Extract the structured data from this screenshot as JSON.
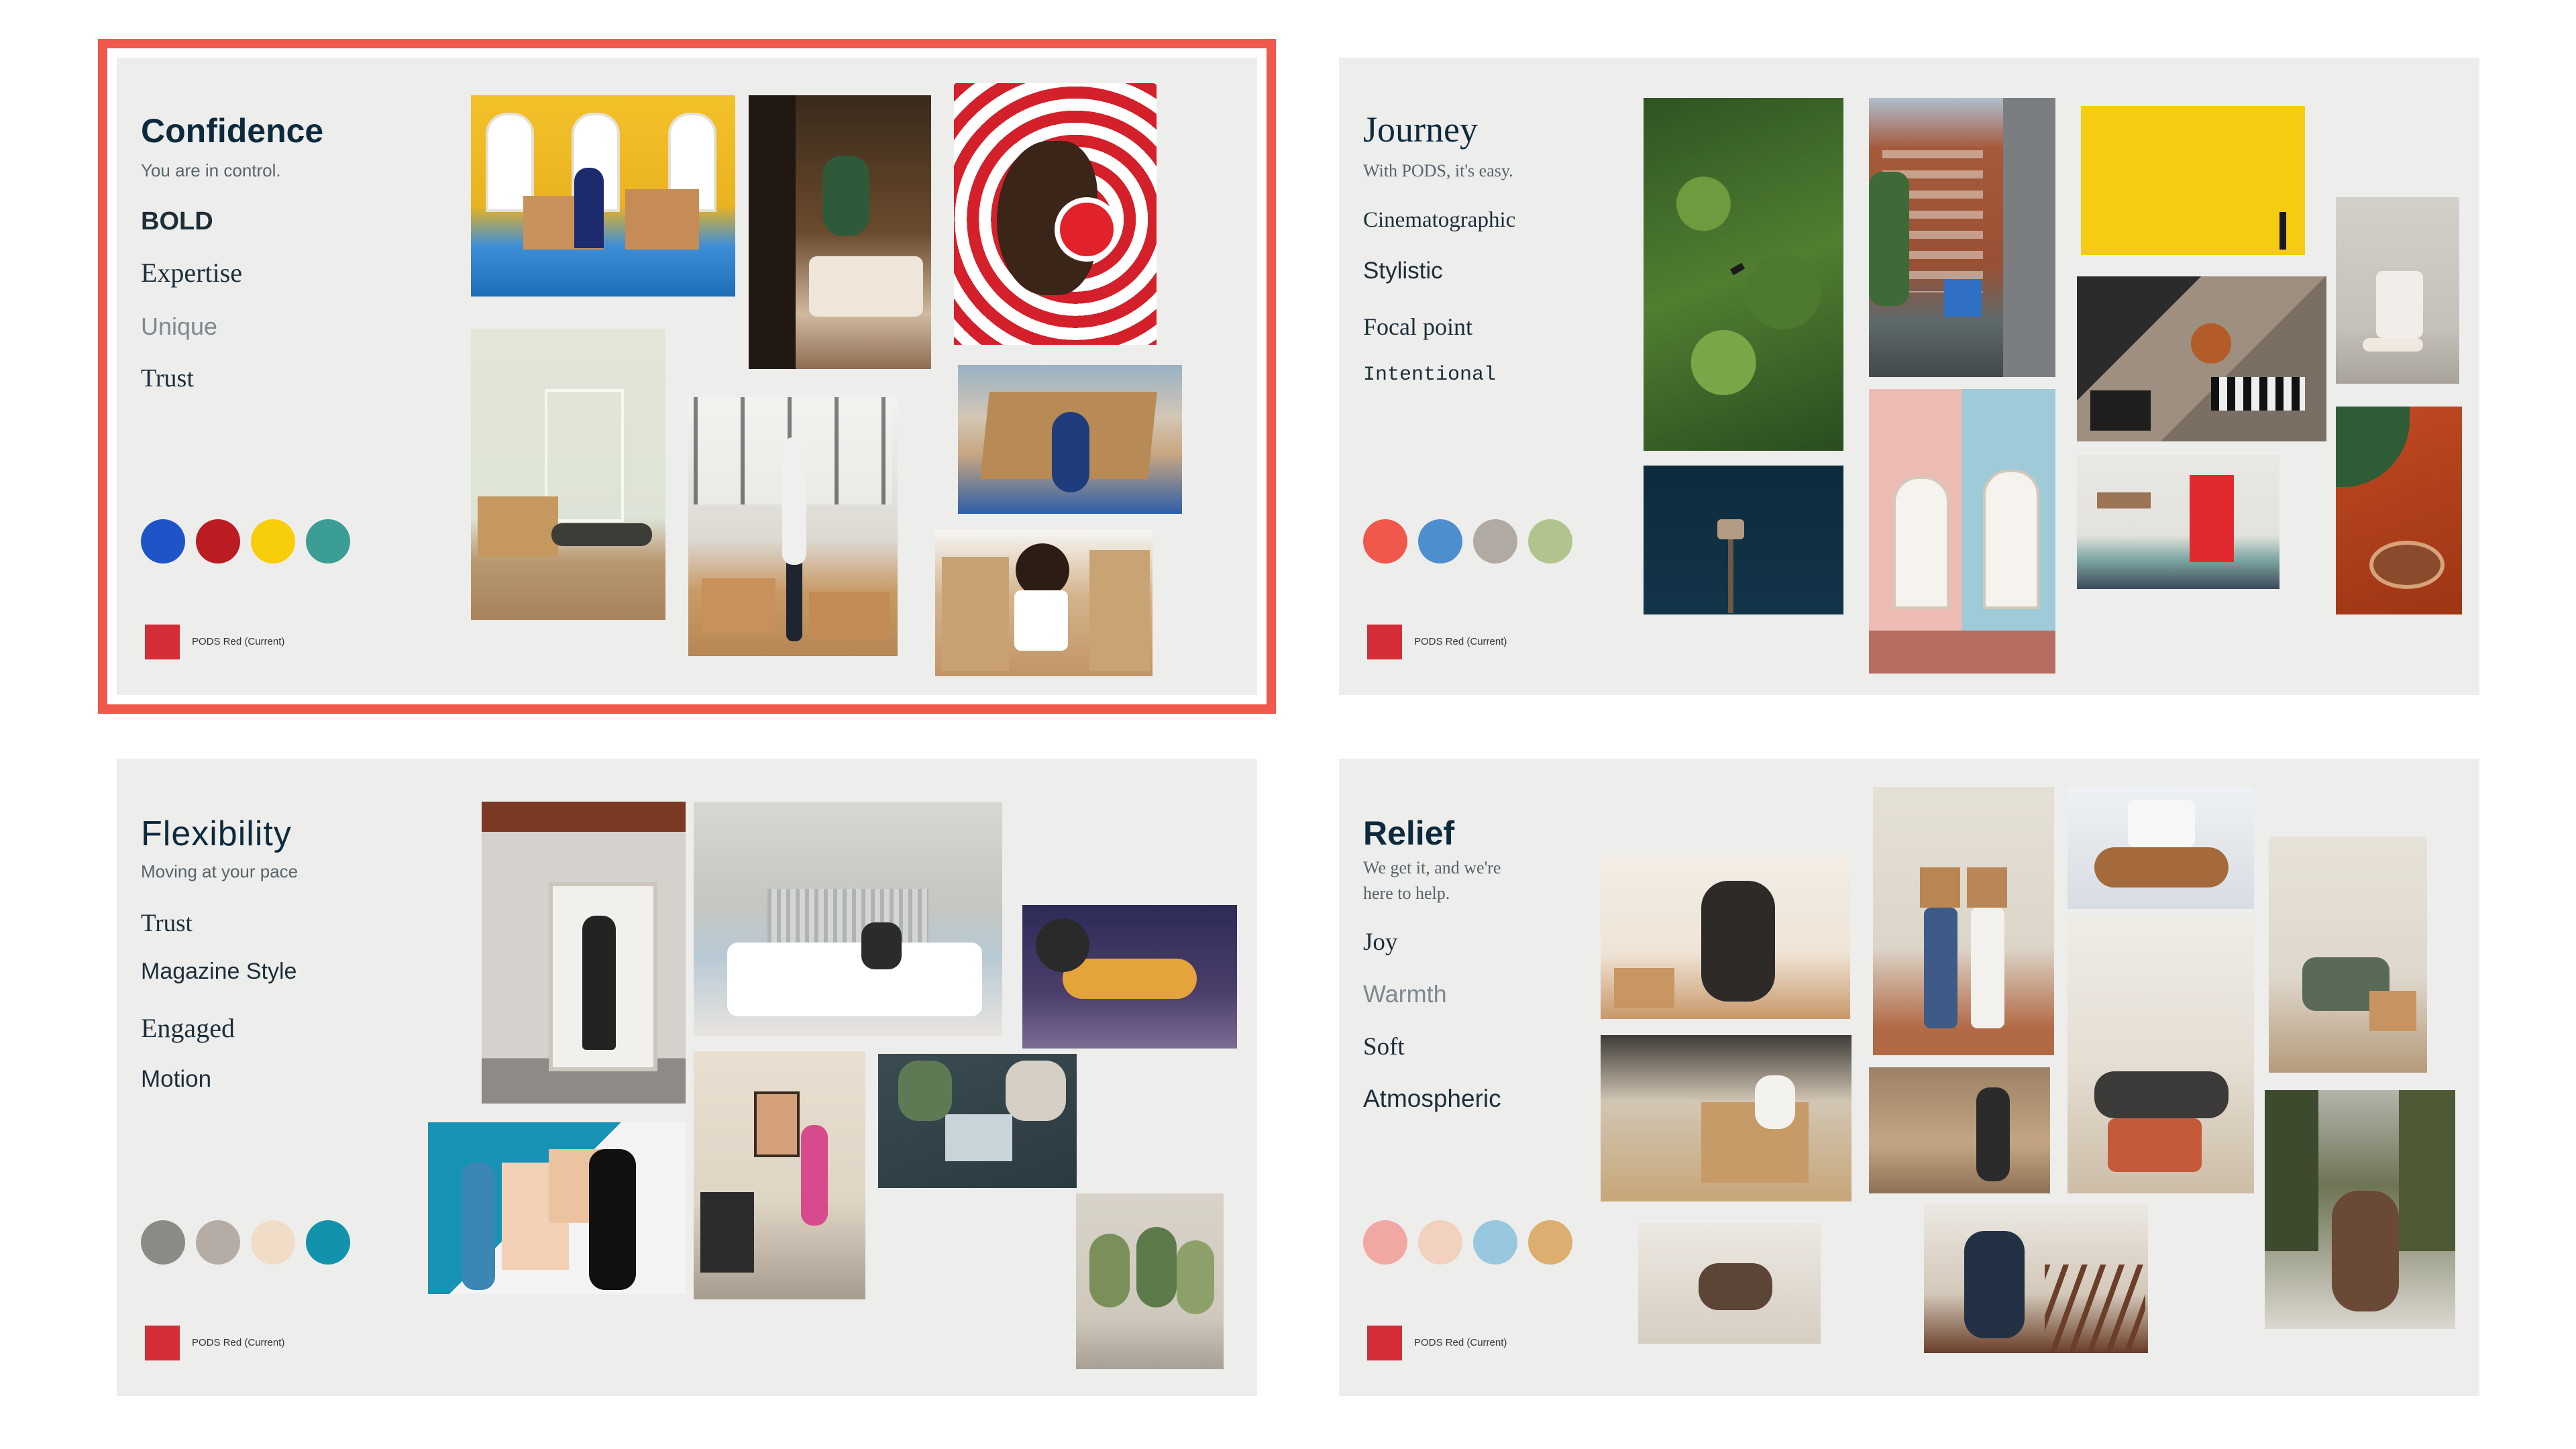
{
  "boards": [
    {
      "title": "Confidence",
      "subtitle": "You are in control.",
      "keywords": [
        "BOLD",
        "Expertise",
        "Unique",
        "Trust"
      ],
      "swatches": [
        "#1e54c8",
        "#bb1c22",
        "#f8ce0a",
        "#3b9d93"
      ],
      "pods_label": "PODS Red (Current)",
      "selected": true
    },
    {
      "title": "Journey",
      "subtitle": "With PODS, it's easy.",
      "keywords": [
        "Cinematographic",
        "Stylistic",
        "Focal point",
        "Intentional"
      ],
      "swatches": [
        "#f0584c",
        "#4d8fcc",
        "#b0aaa3",
        "#b2c48e"
      ],
      "pods_label": "PODS Red (Current)",
      "selected": false
    },
    {
      "title": "Flexibility",
      "subtitle": "Moving at your pace",
      "keywords": [
        "Trust",
        "Magazine Style",
        "Engaged",
        "Motion"
      ],
      "swatches": [
        "#8c8a84",
        "#b5ada5",
        "#f1dcc7",
        "#1392ab"
      ],
      "pods_label": "PODS Red (Current)",
      "selected": false
    },
    {
      "title": "Relief",
      "subtitle_lines": [
        "We get it, and we're",
        "here to help."
      ],
      "keywords": [
        "Joy",
        "Warmth",
        "Soft",
        "Atmospheric"
      ],
      "swatches": [
        "#f1a8a3",
        "#f2d1bf",
        "#98c8df",
        "#dcae70"
      ],
      "pods_label": "PODS Red (Current)",
      "selected": false
    }
  ]
}
